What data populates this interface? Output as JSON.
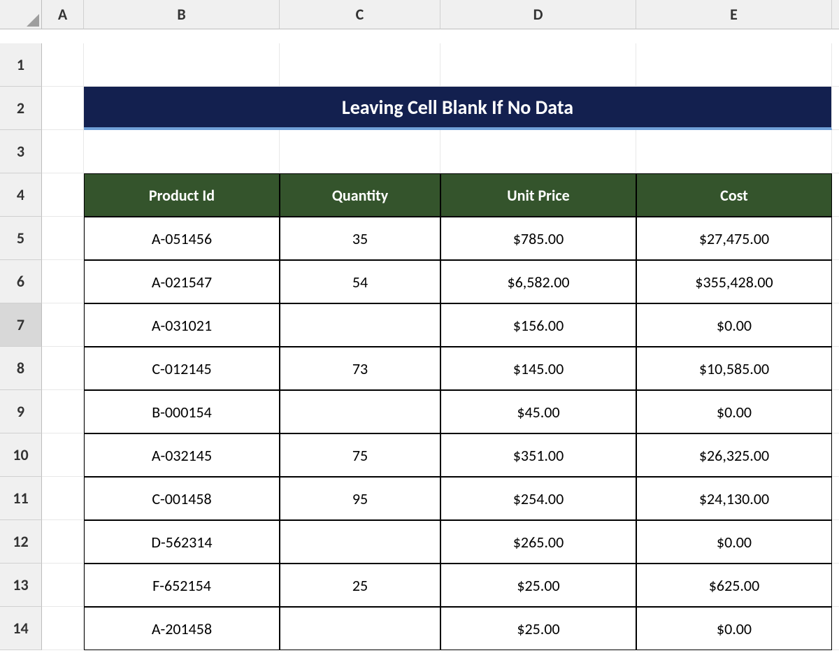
{
  "columns": [
    "A",
    "B",
    "C",
    "D",
    "E"
  ],
  "rows": [
    "1",
    "2",
    "3",
    "4",
    "5",
    "6",
    "7",
    "8",
    "9",
    "10",
    "11",
    "12",
    "13",
    "14"
  ],
  "selected_row": "7",
  "title": "Leaving Cell Blank If No Data",
  "table": {
    "headers": [
      "Product Id",
      "Quantity",
      "Unit Price",
      "Cost"
    ],
    "data": [
      {
        "id": "A-051456",
        "qty": "35",
        "price": "$785.00",
        "cost": "$27,475.00"
      },
      {
        "id": "A-021547",
        "qty": "54",
        "price": "$6,582.00",
        "cost": "$355,428.00"
      },
      {
        "id": "A-031021",
        "qty": "",
        "price": "$156.00",
        "cost": "$0.00"
      },
      {
        "id": "C-012145",
        "qty": "73",
        "price": "$145.00",
        "cost": "$10,585.00"
      },
      {
        "id": "B-000154",
        "qty": "",
        "price": "$45.00",
        "cost": "$0.00"
      },
      {
        "id": "A-032145",
        "qty": "75",
        "price": "$351.00",
        "cost": "$26,325.00"
      },
      {
        "id": "C-001458",
        "qty": "95",
        "price": "$254.00",
        "cost": "$24,130.00"
      },
      {
        "id": "D-562314",
        "qty": "",
        "price": "$265.00",
        "cost": "$0.00"
      },
      {
        "id": "F-652154",
        "qty": "25",
        "price": "$25.00",
        "cost": "$625.00"
      },
      {
        "id": "A-201458",
        "qty": "",
        "price": "$25.00",
        "cost": "$0.00"
      }
    ]
  }
}
